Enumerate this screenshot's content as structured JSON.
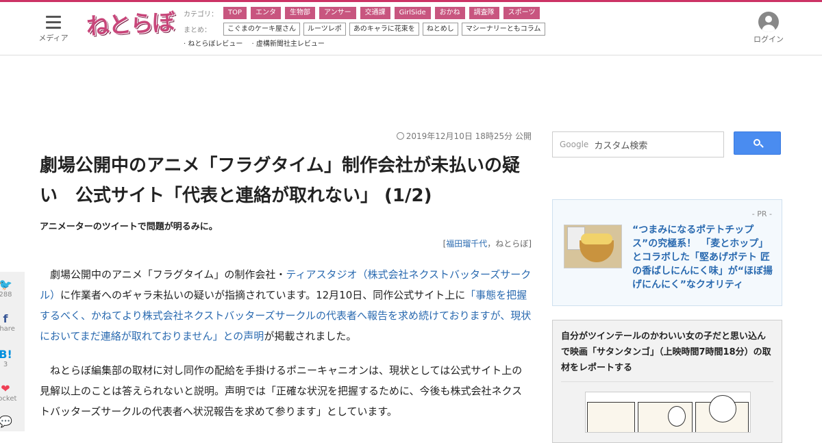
{
  "header": {
    "menu_label": "メディア",
    "logo_text": "ねとらぼ",
    "category_label": "カテゴリ：",
    "categories": [
      "TOP",
      "エンタ",
      "生物部",
      "アンサー",
      "交通課",
      "GirlSide",
      "おかね",
      "調査隊",
      "スポーツ"
    ],
    "matome_label": "まとめ：",
    "matome": [
      "こぐまのケーキ屋さん",
      "ルーツレポ",
      "あのキャラに花束を",
      "ねとめし",
      "マシーナリーともコラム"
    ],
    "reviews": [
      "· ねとらぼレビュー",
      "· 虚構新聞社主レビュー"
    ],
    "login_label": "ログイン"
  },
  "article": {
    "date": "2019年12月10日 18時25分 公開",
    "title": "劇場公開中のアニメ「フラグタイム」制作会社が未払いの疑い　公式サイト「代表と連絡が取れない」 (1/2)",
    "lead": "アニメーターのツイートで問題が明るみに。",
    "author_open": "[",
    "author_name": "福田瑠千代",
    "author_sep": "，",
    "author_pub": "ねとらぼ",
    "author_close": "]",
    "p1_a": "劇場公開中のアニメ「フラグタイム」の制作会社・",
    "p1_link1": "ティアスタジオ（株式会社ネクストバッターズサークル）",
    "p1_b": "に作業者へのギャラ未払いの疑いが指摘されています。12月10日、同作公式サイト上に",
    "p1_link2": "「事態を把握するべく、かねてより株式会社ネクストバッターズサークルの代表者へ報告を求め続けておりますが、現状においてまだ連絡が取れておりません」との声明",
    "p1_c": "が掲載されました。",
    "p2": "ねとらぼ編集部の取材に対し同作の配給を手掛けるポニーキャニオンは、現状としては公式サイト上の見解以上のことは答えられないと説明。声明では「正確な状況を把握するために、今後も株式会社ネクストバッターズサークルの代表者へ状況報告を求めて参ります」としています。"
  },
  "share": [
    {
      "icon": "twitter-icon",
      "glyph": "🐦",
      "count": "288"
    },
    {
      "icon": "facebook-icon",
      "glyph": "f",
      "count": "share"
    },
    {
      "icon": "hatena-icon",
      "glyph": "B!",
      "count": "3"
    },
    {
      "icon": "pocket-icon",
      "glyph": "❤",
      "count": "Pocket"
    },
    {
      "icon": "comment-icon",
      "glyph": "💬",
      "count": ""
    }
  ],
  "sidebar": {
    "search_brand": "Google",
    "search_placeholder": "カスタム検索",
    "pr_label": "- PR -",
    "pr_text": "“つまみになるポテトチップス”の究極系！　「麦とホップ」とコラボした「堅あげポテト 匠の香ばしにんにく味」が“ほぼ揚げにんにく”なクオリティ",
    "related_title": "自分がツインテールのかわいい女の子だと思い込んで映画「サタンタンゴ」（上映時間7時間18分）の取材をレポートする"
  },
  "colors": {
    "accent": "#c8557f",
    "link": "#2a6ab0",
    "search_button": "#4a8cf0"
  }
}
